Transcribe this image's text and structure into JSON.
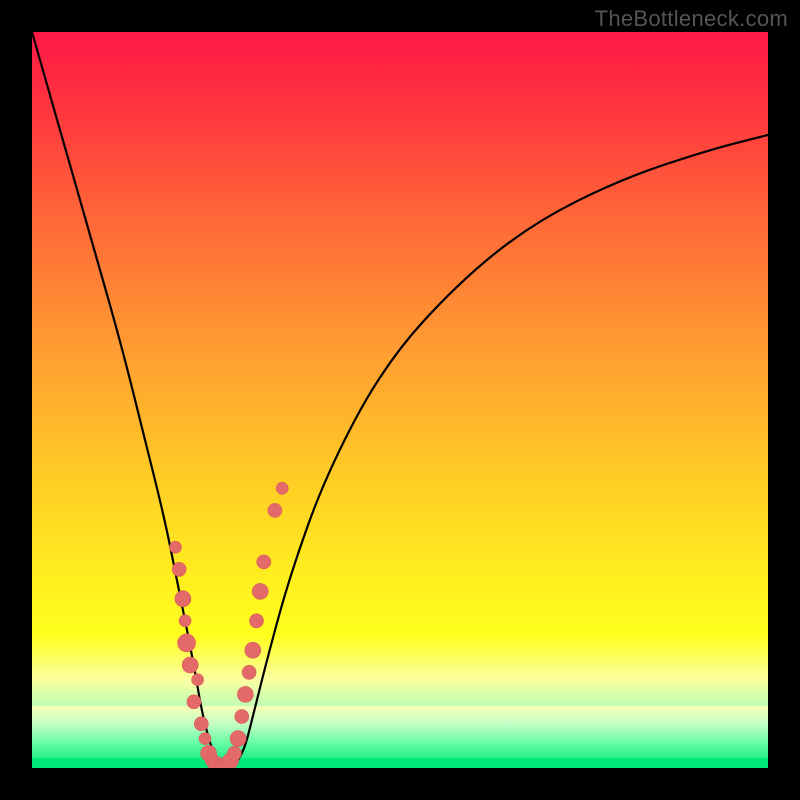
{
  "watermark": "TheBottleneck.com",
  "colors": {
    "frame": "#000000",
    "curve": "#000000",
    "dot_fill": "#e46a6a",
    "gradient_top": "#ff1846",
    "gradient_bottom": "#00e87a"
  },
  "chart_data": {
    "type": "line",
    "title": "",
    "xlabel": "",
    "ylabel": "",
    "xlim": [
      0,
      100
    ],
    "ylim": [
      0,
      100
    ],
    "series": [
      {
        "name": "bottleneck-curve",
        "x": [
          0,
          4,
          8,
          12,
          15,
          18,
          20,
          22,
          23,
          24,
          25,
          26,
          27,
          28,
          29,
          30,
          32,
          35,
          40,
          48,
          58,
          68,
          80,
          92,
          100
        ],
        "y": [
          100,
          86,
          72,
          58,
          46,
          34,
          24,
          14,
          8,
          4,
          1,
          0,
          0,
          1,
          3,
          7,
          15,
          26,
          40,
          55,
          66,
          74,
          80,
          84,
          86
        ]
      }
    ],
    "points": {
      "name": "scatter-dots",
      "xy": [
        [
          19.5,
          30
        ],
        [
          20.0,
          27
        ],
        [
          20.5,
          23
        ],
        [
          20.8,
          20
        ],
        [
          21.0,
          17
        ],
        [
          21.5,
          14
        ],
        [
          22.5,
          12
        ],
        [
          22.0,
          9
        ],
        [
          23.0,
          6
        ],
        [
          23.5,
          4
        ],
        [
          24.0,
          2
        ],
        [
          24.5,
          1
        ],
        [
          25.0,
          0.5
        ],
        [
          25.5,
          0.3
        ],
        [
          26.0,
          0.3
        ],
        [
          26.5,
          0.5
        ],
        [
          27.0,
          1
        ],
        [
          27.5,
          2
        ],
        [
          28.0,
          4
        ],
        [
          28.5,
          7
        ],
        [
          29.0,
          10
        ],
        [
          29.5,
          13
        ],
        [
          30.0,
          16
        ],
        [
          30.5,
          20
        ],
        [
          31.0,
          24
        ],
        [
          31.5,
          28
        ],
        [
          33.0,
          35
        ],
        [
          34.0,
          38
        ]
      ],
      "r": [
        6,
        7,
        8,
        6,
        9,
        8,
        6,
        7,
        7,
        6,
        8,
        7,
        8,
        7,
        8,
        7,
        8,
        7,
        8,
        7,
        8,
        7,
        8,
        7,
        8,
        7,
        7,
        6
      ]
    }
  }
}
